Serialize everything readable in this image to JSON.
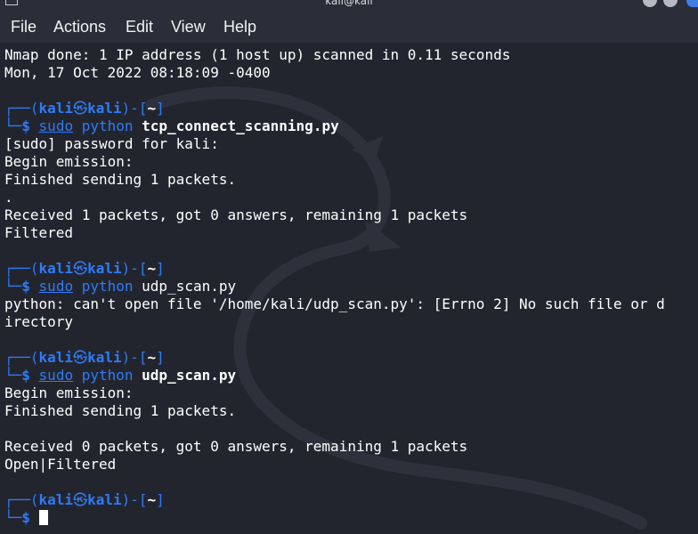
{
  "window": {
    "title": "kali@kali"
  },
  "menu": {
    "file": "File",
    "actions": "Actions",
    "edit": "Edit",
    "view": "View",
    "help": "Help"
  },
  "prompt": {
    "open": "┌──(",
    "user": "kali",
    "at": "㉿",
    "host": "kali",
    "middle": ")-[",
    "cwd": "~",
    "close": "]",
    "arrow": "└─",
    "dollar": "$"
  },
  "output": {
    "nmap_done": "Nmap done: 1 IP address (1 host up) scanned in 0.11 seconds",
    "date": "Mon, 17 Oct 2022 08:18:09 -0400",
    "sudo_password": "[sudo] password for kali:",
    "begin_emission_1": "Begin emission:",
    "finished_sending_1": "Finished sending 1 packets.",
    "dot": ".",
    "received_1": "Received 1 packets, got 0 answers, remaining 1 packets",
    "filtered": "Filtered",
    "error_line_1": "python: can't open file '/home/kali/udp_scan.py': [Errno 2] No such file or d",
    "error_line_2": "irectory",
    "begin_emission_2": "Begin emission:",
    "finished_sending_2": "Finished sending 1 packets.",
    "received_2": "Received 0 packets, got 0 answers, remaining 1 packets",
    "open_filtered": "Open|Filtered"
  },
  "commands": {
    "cmd1": {
      "sudo": "sudo",
      "python": "python",
      "arg": "tcp_connect_scanning.py"
    },
    "cmd2": {
      "sudo": "sudo",
      "python": "python",
      "arg": "udp_scan.py"
    },
    "cmd3": {
      "sudo": "sudo",
      "python": "python",
      "arg": "udp_scan.py"
    }
  },
  "colors": {
    "background": "#23252e",
    "menubar": "#2b2e38",
    "prompt_blue": "#2f7bf6",
    "text": "#ffffff"
  }
}
